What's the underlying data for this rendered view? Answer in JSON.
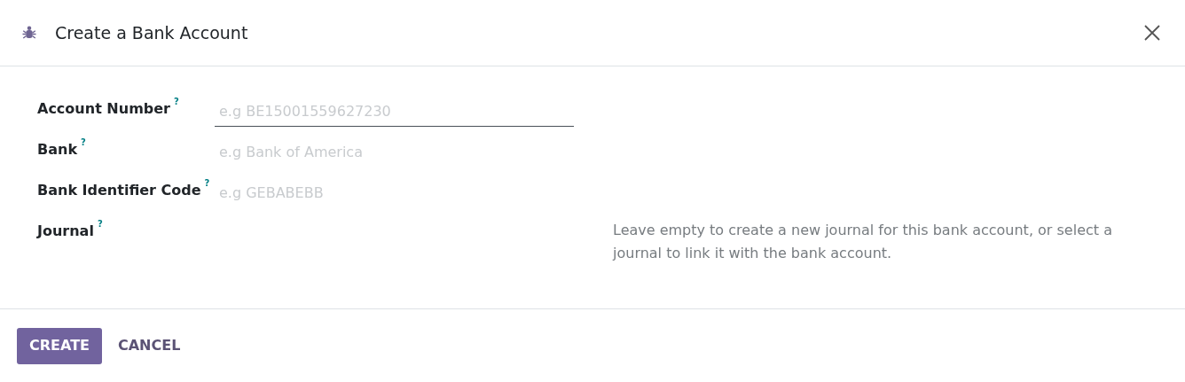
{
  "dialog": {
    "title": "Create a Bank Account"
  },
  "fields": [
    {
      "label": "Account Number",
      "tooltip_mark": "?",
      "placeholder": "e.g BE15001559627230",
      "focused": true
    },
    {
      "label": "Bank",
      "tooltip_mark": "?",
      "placeholder": "e.g Bank of America",
      "focused": false
    },
    {
      "label": "Bank Identifier Code",
      "tooltip_mark": "?",
      "placeholder": "e.g GEBABEBB",
      "focused": false
    },
    {
      "label": "Journal",
      "tooltip_mark": "?",
      "focused": false,
      "help": "Leave empty to create a new journal for this bank account, or select a journal to link it with the bank account."
    }
  ],
  "buttons": [
    {
      "label": "CREATE",
      "kind": "primary"
    },
    {
      "label": "CANCEL",
      "kind": "secondary"
    }
  ]
}
